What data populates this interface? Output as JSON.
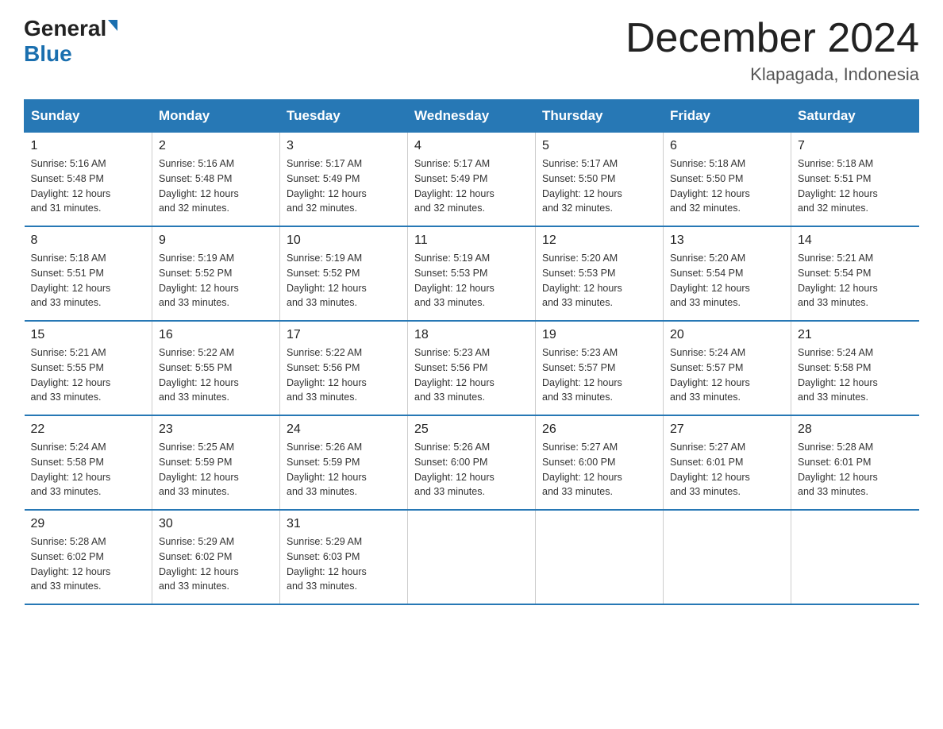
{
  "logo": {
    "general": "General",
    "blue": "Blue",
    "triangle": "▲"
  },
  "title": "December 2024",
  "subtitle": "Klapagada, Indonesia",
  "days_of_week": [
    "Sunday",
    "Monday",
    "Tuesday",
    "Wednesday",
    "Thursday",
    "Friday",
    "Saturday"
  ],
  "weeks": [
    [
      {
        "day": "1",
        "info": "Sunrise: 5:16 AM\nSunset: 5:48 PM\nDaylight: 12 hours\nand 31 minutes."
      },
      {
        "day": "2",
        "info": "Sunrise: 5:16 AM\nSunset: 5:48 PM\nDaylight: 12 hours\nand 32 minutes."
      },
      {
        "day": "3",
        "info": "Sunrise: 5:17 AM\nSunset: 5:49 PM\nDaylight: 12 hours\nand 32 minutes."
      },
      {
        "day": "4",
        "info": "Sunrise: 5:17 AM\nSunset: 5:49 PM\nDaylight: 12 hours\nand 32 minutes."
      },
      {
        "day": "5",
        "info": "Sunrise: 5:17 AM\nSunset: 5:50 PM\nDaylight: 12 hours\nand 32 minutes."
      },
      {
        "day": "6",
        "info": "Sunrise: 5:18 AM\nSunset: 5:50 PM\nDaylight: 12 hours\nand 32 minutes."
      },
      {
        "day": "7",
        "info": "Sunrise: 5:18 AM\nSunset: 5:51 PM\nDaylight: 12 hours\nand 32 minutes."
      }
    ],
    [
      {
        "day": "8",
        "info": "Sunrise: 5:18 AM\nSunset: 5:51 PM\nDaylight: 12 hours\nand 33 minutes."
      },
      {
        "day": "9",
        "info": "Sunrise: 5:19 AM\nSunset: 5:52 PM\nDaylight: 12 hours\nand 33 minutes."
      },
      {
        "day": "10",
        "info": "Sunrise: 5:19 AM\nSunset: 5:52 PM\nDaylight: 12 hours\nand 33 minutes."
      },
      {
        "day": "11",
        "info": "Sunrise: 5:19 AM\nSunset: 5:53 PM\nDaylight: 12 hours\nand 33 minutes."
      },
      {
        "day": "12",
        "info": "Sunrise: 5:20 AM\nSunset: 5:53 PM\nDaylight: 12 hours\nand 33 minutes."
      },
      {
        "day": "13",
        "info": "Sunrise: 5:20 AM\nSunset: 5:54 PM\nDaylight: 12 hours\nand 33 minutes."
      },
      {
        "day": "14",
        "info": "Sunrise: 5:21 AM\nSunset: 5:54 PM\nDaylight: 12 hours\nand 33 minutes."
      }
    ],
    [
      {
        "day": "15",
        "info": "Sunrise: 5:21 AM\nSunset: 5:55 PM\nDaylight: 12 hours\nand 33 minutes."
      },
      {
        "day": "16",
        "info": "Sunrise: 5:22 AM\nSunset: 5:55 PM\nDaylight: 12 hours\nand 33 minutes."
      },
      {
        "day": "17",
        "info": "Sunrise: 5:22 AM\nSunset: 5:56 PM\nDaylight: 12 hours\nand 33 minutes."
      },
      {
        "day": "18",
        "info": "Sunrise: 5:23 AM\nSunset: 5:56 PM\nDaylight: 12 hours\nand 33 minutes."
      },
      {
        "day": "19",
        "info": "Sunrise: 5:23 AM\nSunset: 5:57 PM\nDaylight: 12 hours\nand 33 minutes."
      },
      {
        "day": "20",
        "info": "Sunrise: 5:24 AM\nSunset: 5:57 PM\nDaylight: 12 hours\nand 33 minutes."
      },
      {
        "day": "21",
        "info": "Sunrise: 5:24 AM\nSunset: 5:58 PM\nDaylight: 12 hours\nand 33 minutes."
      }
    ],
    [
      {
        "day": "22",
        "info": "Sunrise: 5:24 AM\nSunset: 5:58 PM\nDaylight: 12 hours\nand 33 minutes."
      },
      {
        "day": "23",
        "info": "Sunrise: 5:25 AM\nSunset: 5:59 PM\nDaylight: 12 hours\nand 33 minutes."
      },
      {
        "day": "24",
        "info": "Sunrise: 5:26 AM\nSunset: 5:59 PM\nDaylight: 12 hours\nand 33 minutes."
      },
      {
        "day": "25",
        "info": "Sunrise: 5:26 AM\nSunset: 6:00 PM\nDaylight: 12 hours\nand 33 minutes."
      },
      {
        "day": "26",
        "info": "Sunrise: 5:27 AM\nSunset: 6:00 PM\nDaylight: 12 hours\nand 33 minutes."
      },
      {
        "day": "27",
        "info": "Sunrise: 5:27 AM\nSunset: 6:01 PM\nDaylight: 12 hours\nand 33 minutes."
      },
      {
        "day": "28",
        "info": "Sunrise: 5:28 AM\nSunset: 6:01 PM\nDaylight: 12 hours\nand 33 minutes."
      }
    ],
    [
      {
        "day": "29",
        "info": "Sunrise: 5:28 AM\nSunset: 6:02 PM\nDaylight: 12 hours\nand 33 minutes."
      },
      {
        "day": "30",
        "info": "Sunrise: 5:29 AM\nSunset: 6:02 PM\nDaylight: 12 hours\nand 33 minutes."
      },
      {
        "day": "31",
        "info": "Sunrise: 5:29 AM\nSunset: 6:03 PM\nDaylight: 12 hours\nand 33 minutes."
      },
      null,
      null,
      null,
      null
    ]
  ]
}
